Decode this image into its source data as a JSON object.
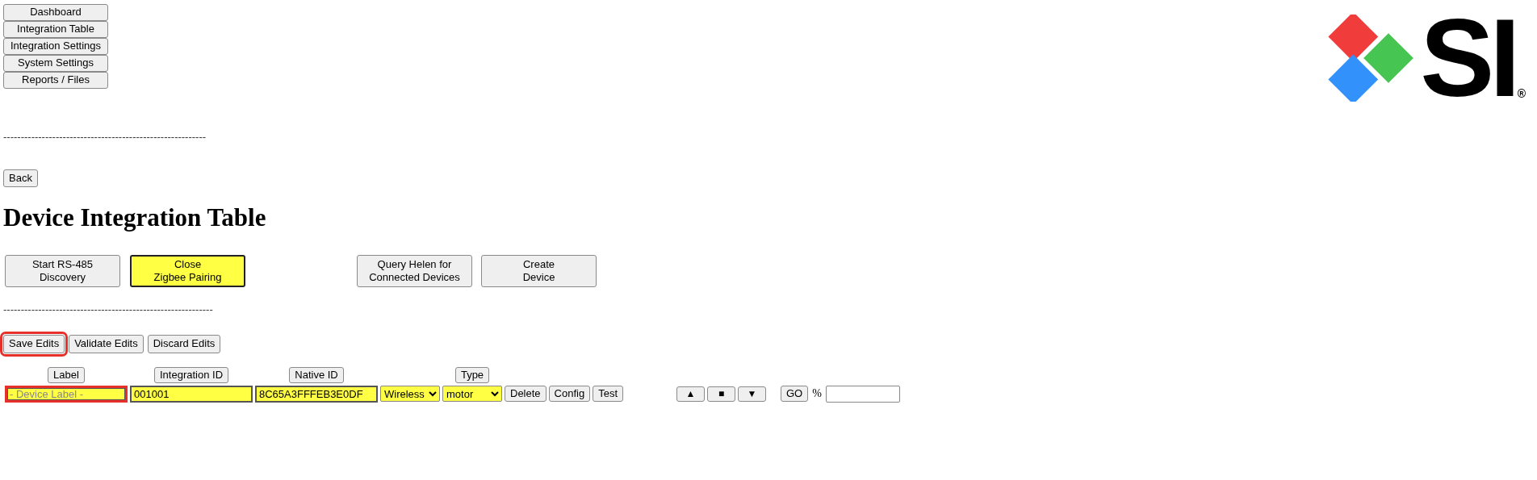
{
  "nav": [
    {
      "label": "Dashboard"
    },
    {
      "label": "Integration Table"
    },
    {
      "label": "Integration Settings"
    },
    {
      "label": "System Settings"
    },
    {
      "label": "Reports / Files"
    }
  ],
  "logo": {
    "text": "SI",
    "registered": "®"
  },
  "separator_top": "----------------------------------------------------------",
  "back_button": "Back",
  "heading": "Device Integration Table",
  "actions": [
    {
      "lines": [
        "Start RS-485",
        "Discovery"
      ],
      "active": false
    },
    {
      "lines": [
        "Close",
        "Zigbee Pairing"
      ],
      "active": true
    },
    {
      "lines": [
        "Query Helen for",
        "Connected Devices"
      ],
      "active": false
    },
    {
      "lines": [
        "Create",
        "Device"
      ],
      "active": false
    }
  ],
  "separator_mid": "------------------------------------------------------------",
  "edit_buttons": [
    {
      "label": "Save Edits",
      "highlighted": true
    },
    {
      "label": "Validate Edits",
      "highlighted": false
    },
    {
      "label": "Discard Edits",
      "highlighted": false
    }
  ],
  "columns": [
    "Label",
    "Integration ID",
    "Native ID",
    "Type"
  ],
  "device": {
    "label": {
      "placeholder": "- Device Label -",
      "highlighted": true
    },
    "integration_id": "001001",
    "native_id": "8C65A3FFFEB3E0DF",
    "protocol": "Wireless",
    "type": "motor",
    "buttons": [
      "Delete",
      "Config",
      "Test"
    ],
    "motion_buttons": [
      "▲",
      "■",
      "▼"
    ],
    "go_button": "GO",
    "percent_label": "%"
  }
}
